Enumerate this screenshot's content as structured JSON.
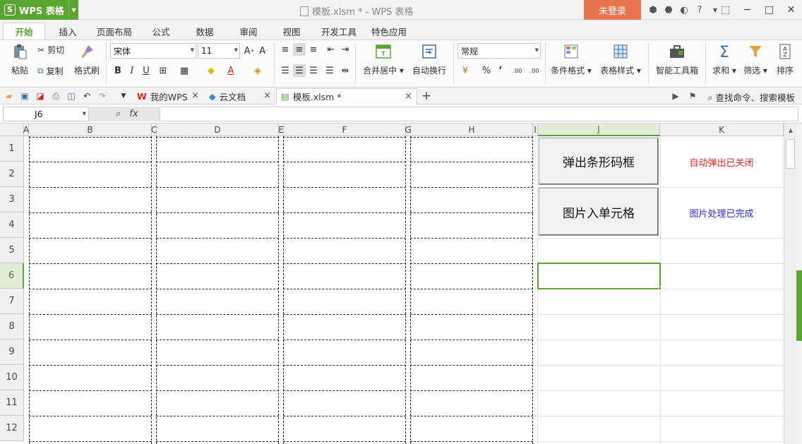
{
  "app": {
    "name": "WPS 表格",
    "logo_letter": "S",
    "window_title": "模板.xlsm * - WPS 表格",
    "login_label": "未登录"
  },
  "menu": {
    "tabs": [
      "开始",
      "插入",
      "页面布局",
      "公式",
      "数据",
      "审阅",
      "视图",
      "开发工具",
      "特色应用"
    ],
    "active": "开始"
  },
  "ribbon": {
    "paste": "粘贴",
    "cut": "剪切",
    "copy": "复制",
    "format_painter": "格式刷",
    "font_name": "宋体",
    "font_size": "11",
    "bold": "B",
    "italic": "I",
    "underline": "U",
    "merge_center": "合并居中",
    "wrap_text": "自动换行",
    "number_format": "常规",
    "percent": "%",
    "comma": "’",
    "inc_decimal": ".00",
    "dec_decimal": ".00",
    "conditional_format": "条件格式",
    "table_style": "表格样式",
    "smart_toolbox": "智能工具箱",
    "sum": "求和",
    "filter": "筛选",
    "sort": "排序"
  },
  "doc_tabs": [
    {
      "label": "我的WPS"
    },
    {
      "label": "云文档"
    },
    {
      "label": "模板.xlsm *"
    }
  ],
  "search_cmd": "查找命令、搜索模板",
  "formula_bar": {
    "name_box": "J6",
    "fx": "fx",
    "value": ""
  },
  "sheet": {
    "columns": [
      "A",
      "B",
      "C",
      "D",
      "E",
      "F",
      "G",
      "H",
      "I",
      "J",
      "K"
    ],
    "rows": [
      "1",
      "2",
      "3",
      "4",
      "5",
      "6",
      "7",
      "8",
      "9",
      "10",
      "11",
      "12"
    ],
    "selected_cell": "J6",
    "buttons": {
      "barcode": "弹出条形码框",
      "image_to_cell": "图片入单元格"
    },
    "status_texts": {
      "auto_popup": "自动弹出已关闭",
      "image_done": "图片处理已完成"
    }
  },
  "colors": {
    "accent_green": "#5aa532",
    "login_orange": "#e8734f",
    "status_red": "#e02020",
    "status_blue": "#2a2ad0"
  }
}
